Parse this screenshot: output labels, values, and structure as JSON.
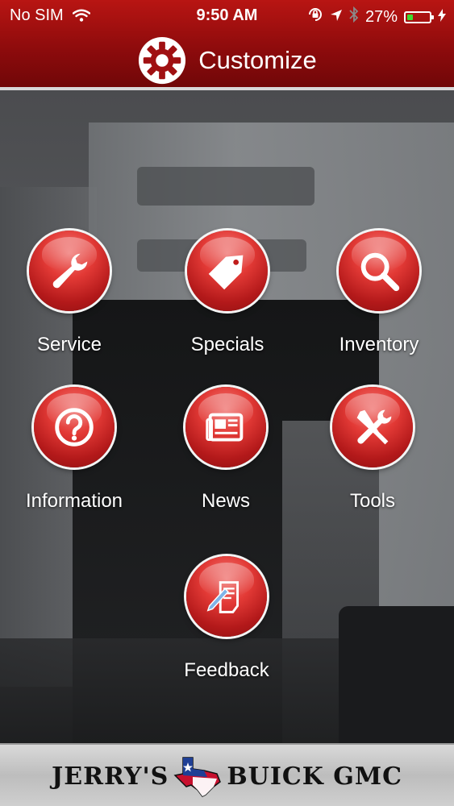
{
  "status_bar": {
    "carrier": "No SIM",
    "time": "9:50 AM",
    "battery": "27%",
    "battery_level": 0.27
  },
  "header": {
    "title": "Customize",
    "icon": "gear-icon"
  },
  "menu": [
    {
      "label": "Service",
      "icon": "wrench-icon"
    },
    {
      "label": "Specials",
      "icon": "tag-icon"
    },
    {
      "label": "Inventory",
      "icon": "magnifier-icon"
    },
    {
      "label": "Information",
      "icon": "question-icon"
    },
    {
      "label": "News",
      "icon": "newspaper-icon"
    },
    {
      "label": "Tools",
      "icon": "tools-icon"
    },
    {
      "label": "Feedback",
      "icon": "feedback-icon"
    }
  ],
  "footer": {
    "brand_left": "JERRY'S",
    "brand_right": "BUICK GMC"
  },
  "colors": {
    "header_red": "#a01012",
    "button_red": "#e33a36",
    "battery_green": "#3ddc2f"
  }
}
